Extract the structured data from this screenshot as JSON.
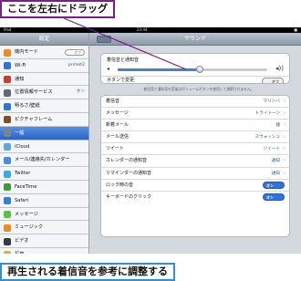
{
  "callouts": {
    "top": "ここを左右にドラッグ",
    "bottom": "再生される着信音を参考に調整する"
  },
  "statusbar": {
    "carrier": "iPad",
    "time": "23:44",
    "battery": "■"
  },
  "sidebar": {
    "title": "設定",
    "items": [
      {
        "label": "機内モード",
        "icon_color": "#f08a24",
        "toggle": "オフ"
      },
      {
        "label": "Wi-Fi",
        "icon_color": "#2f73e0",
        "value": "primet2"
      },
      {
        "label": "通知",
        "icon_color": "#d03a2c"
      },
      {
        "label": "位置情報サービス",
        "icon_color": "#5b6b7d",
        "value": "オン"
      },
      {
        "label": "明るさ/壁紙",
        "icon_color": "#2f73e0"
      },
      {
        "label": "ピクチャフレーム",
        "icon_color": "#7a4f2a"
      },
      {
        "label": "一般",
        "icon_color": "#7d848c",
        "selected": true
      },
      {
        "label": "iCloud",
        "icon_color": "#59a8e8"
      },
      {
        "label": "メール/連絡先/カレンダー",
        "icon_color": "#4a8de0"
      },
      {
        "label": "Twitter",
        "icon_color": "#39a9e0"
      },
      {
        "label": "FaceTime",
        "icon_color": "#3c9b3c"
      },
      {
        "label": "Safari",
        "icon_color": "#3a7fd5"
      },
      {
        "label": "メッセージ",
        "icon_color": "#5cc24a"
      },
      {
        "label": "ミュージック",
        "icon_color": "#f08a24"
      },
      {
        "label": "ビデオ",
        "icon_color": "#333a45"
      },
      {
        "label": "写真",
        "icon_color": "#e0b23a"
      }
    ]
  },
  "main": {
    "title": "サウンド",
    "volume": {
      "label": "着信音と通知音",
      "level": 0.55,
      "min_icon": "◂",
      "max_icon": "◂))"
    },
    "change_with_buttons": {
      "label": "ボタンで変更",
      "toggle": "オフ"
    },
    "note": "着信音と通知音の音量はボリュームボタンを使用して調節されません。",
    "rows": [
      {
        "label": "着信音",
        "value": "マリンバ",
        "chevron": "›"
      },
      {
        "label": "メッセージ",
        "value": "トライトーン",
        "chevron": "›"
      },
      {
        "label": "新着メール",
        "value": "鐘",
        "chevron": "›"
      },
      {
        "label": "メール送信",
        "value": "スウォッシュ",
        "chevron": "›"
      },
      {
        "label": "ツイート",
        "value": "ツイート",
        "chevron": "›"
      },
      {
        "label": "カレンダーの通知音",
        "value": "通知",
        "chevron": "›"
      },
      {
        "label": "リマインダーの通知音",
        "value": "通知",
        "chevron": "›"
      },
      {
        "label": "ロック時の音",
        "toggle": "オン"
      },
      {
        "label": "キーボードのクリック",
        "toggle": "オン"
      }
    ]
  },
  "colors": {
    "callout_top_border": "#7a1f8f",
    "callout_bottom_border": "#2f8fd6",
    "accent": "#2f73e0"
  }
}
